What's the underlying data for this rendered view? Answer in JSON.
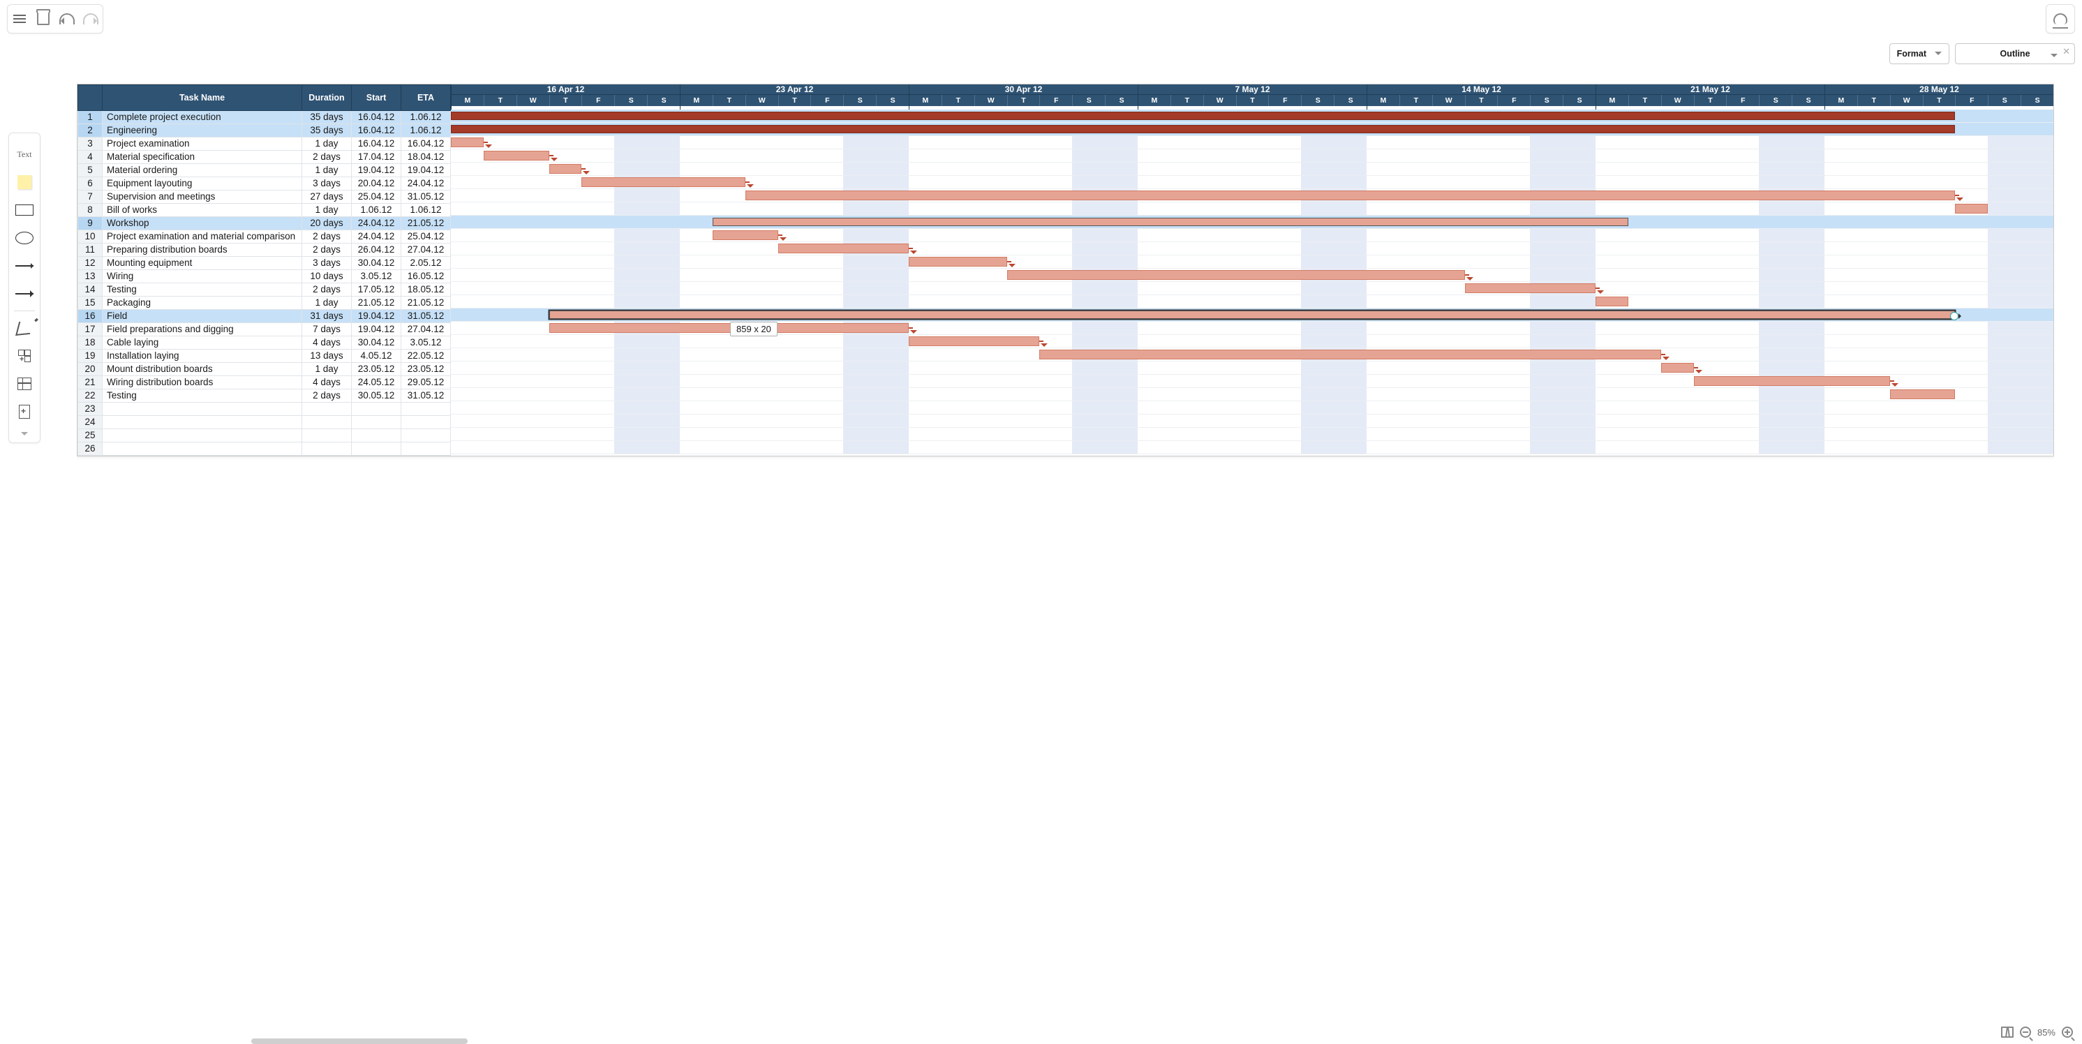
{
  "toolbar": {
    "format_label": "Format",
    "outline_label": "Outline"
  },
  "zoom": {
    "percent_label": "85%"
  },
  "tooltip": {
    "text": "859 x 20"
  },
  "columns": {
    "task": "Task Name",
    "duration": "Duration",
    "start": "Start",
    "eta": "ETA"
  },
  "weeks": [
    "16 Apr 12",
    "23 Apr 12",
    "30 Apr 12",
    "7 May 12",
    "14 May 12",
    "21 May 12",
    "28 May 12"
  ],
  "day_letters": [
    "M",
    "T",
    "W",
    "T",
    "F",
    "S",
    "S"
  ],
  "rows": [
    {
      "n": 1,
      "name": "Complete project execution",
      "dur": "35 days",
      "start": "16.04.12",
      "eta": "1.06.12",
      "summary": true,
      "bar": [
        0,
        46
      ],
      "bartype": "summary"
    },
    {
      "n": 2,
      "name": "Engineering",
      "dur": "35 days",
      "start": "16.04.12",
      "eta": "1.06.12",
      "summary": true,
      "bar": [
        0,
        46
      ],
      "bartype": "summary"
    },
    {
      "n": 3,
      "name": "Project examination",
      "dur": "1 day",
      "start": "16.04.12",
      "eta": "16.04.12",
      "summary": false,
      "bar": [
        0,
        1
      ],
      "link": true
    },
    {
      "n": 4,
      "name": "Material specification",
      "dur": "2 days",
      "start": "17.04.12",
      "eta": "18.04.12",
      "summary": false,
      "bar": [
        1,
        3
      ],
      "link": true
    },
    {
      "n": 5,
      "name": "Material ordering",
      "dur": "1 day",
      "start": "19.04.12",
      "eta": "19.04.12",
      "summary": false,
      "bar": [
        3,
        4
      ],
      "link": true
    },
    {
      "n": 6,
      "name": "Equipment layouting",
      "dur": "3 days",
      "start": "20.04.12",
      "eta": "24.04.12",
      "summary": false,
      "bar": [
        4,
        9
      ],
      "link": true
    },
    {
      "n": 7,
      "name": "Supervision and meetings",
      "dur": "27 days",
      "start": "25.04.12",
      "eta": "31.05.12",
      "summary": false,
      "bar": [
        9,
        46
      ],
      "link": true
    },
    {
      "n": 8,
      "name": "Bill of works",
      "dur": "1 day",
      "start": "1.06.12",
      "eta": "1.06.12",
      "summary": false,
      "bar": [
        46,
        47
      ]
    },
    {
      "n": 9,
      "name": "Workshop",
      "dur": "20 days",
      "start": "24.04.12",
      "eta": "21.05.12",
      "summary": true,
      "bar": [
        8,
        36
      ],
      "bartype": "outlined"
    },
    {
      "n": 10,
      "name": "Project examination and material comparison",
      "dur": "2 days",
      "start": "24.04.12",
      "eta": "25.04.12",
      "summary": false,
      "bar": [
        8,
        10
      ],
      "link": true
    },
    {
      "n": 11,
      "name": "Preparing distribution boards",
      "dur": "2 days",
      "start": "26.04.12",
      "eta": "27.04.12",
      "summary": false,
      "bar": [
        10,
        14
      ],
      "link": true
    },
    {
      "n": 12,
      "name": "Mounting equipment",
      "dur": "3 days",
      "start": "30.04.12",
      "eta": "2.05.12",
      "summary": false,
      "bar": [
        14,
        17
      ],
      "link": true
    },
    {
      "n": 13,
      "name": "Wiring",
      "dur": "10 days",
      "start": "3.05.12",
      "eta": "16.05.12",
      "summary": false,
      "bar": [
        17,
        31
      ],
      "link": true
    },
    {
      "n": 14,
      "name": "Testing",
      "dur": "2 days",
      "start": "17.05.12",
      "eta": "18.05.12",
      "summary": false,
      "bar": [
        31,
        35
      ],
      "link": true
    },
    {
      "n": 15,
      "name": "Packaging",
      "dur": "1 day",
      "start": "21.05.12",
      "eta": "21.05.12",
      "summary": false,
      "bar": [
        35,
        36
      ]
    },
    {
      "n": 16,
      "name": "Field",
      "dur": "31 days",
      "start": "19.04.12",
      "eta": "31.05.12",
      "summary": true,
      "bar": [
        3,
        46
      ],
      "bartype": "selected"
    },
    {
      "n": 17,
      "name": "Field preparations and digging",
      "dur": "7 days",
      "start": "19.04.12",
      "eta": "27.04.12",
      "summary": false,
      "bar": [
        3,
        14
      ],
      "link": true
    },
    {
      "n": 18,
      "name": "Cable laying",
      "dur": "4 days",
      "start": "30.04.12",
      "eta": "3.05.12",
      "summary": false,
      "bar": [
        14,
        18
      ],
      "link": true
    },
    {
      "n": 19,
      "name": "Installation laying",
      "dur": "13 days",
      "start": "4.05.12",
      "eta": "22.05.12",
      "summary": false,
      "bar": [
        18,
        37
      ],
      "link": true
    },
    {
      "n": 20,
      "name": "Mount distribution boards",
      "dur": "1 day",
      "start": "23.05.12",
      "eta": "23.05.12",
      "summary": false,
      "bar": [
        37,
        38
      ],
      "link": true
    },
    {
      "n": 21,
      "name": "Wiring distribution boards",
      "dur": "4 days",
      "start": "24.05.12",
      "eta": "29.05.12",
      "summary": false,
      "bar": [
        38,
        44
      ],
      "link": true
    },
    {
      "n": 22,
      "name": "Testing",
      "dur": "2 days",
      "start": "30.05.12",
      "eta": "31.05.12",
      "summary": false,
      "bar": [
        44,
        46
      ]
    },
    {
      "n": 23,
      "name": "",
      "dur": "",
      "start": "",
      "eta": "",
      "summary": false
    },
    {
      "n": 24,
      "name": "",
      "dur": "",
      "start": "",
      "eta": "",
      "summary": false
    },
    {
      "n": 25,
      "name": "",
      "dur": "",
      "start": "",
      "eta": "",
      "summary": false
    },
    {
      "n": 26,
      "name": "",
      "dur": "",
      "start": "",
      "eta": "",
      "summary": false
    }
  ],
  "chart_data": {
    "type": "table",
    "title": "Gantt chart — Complete project execution",
    "columns": [
      "#",
      "Task Name",
      "Duration",
      "Start",
      "ETA"
    ],
    "date_range_start": "16.04.12",
    "date_range_end": "3.06.12",
    "rows": [
      [
        1,
        "Complete project execution",
        "35 days",
        "16.04.12",
        "1.06.12"
      ],
      [
        2,
        "Engineering",
        "35 days",
        "16.04.12",
        "1.06.12"
      ],
      [
        3,
        "Project examination",
        "1 day",
        "16.04.12",
        "16.04.12"
      ],
      [
        4,
        "Material specification",
        "2 days",
        "17.04.12",
        "18.04.12"
      ],
      [
        5,
        "Material ordering",
        "1 day",
        "19.04.12",
        "19.04.12"
      ],
      [
        6,
        "Equipment layouting",
        "3 days",
        "20.04.12",
        "24.04.12"
      ],
      [
        7,
        "Supervision and meetings",
        "27 days",
        "25.04.12",
        "31.05.12"
      ],
      [
        8,
        "Bill of works",
        "1 day",
        "1.06.12",
        "1.06.12"
      ],
      [
        9,
        "Workshop",
        "20 days",
        "24.04.12",
        "21.05.12"
      ],
      [
        10,
        "Project examination and material comparison",
        "2 days",
        "24.04.12",
        "25.04.12"
      ],
      [
        11,
        "Preparing distribution boards",
        "2 days",
        "26.04.12",
        "27.04.12"
      ],
      [
        12,
        "Mounting equipment",
        "3 days",
        "30.04.12",
        "2.05.12"
      ],
      [
        13,
        "Wiring",
        "10 days",
        "3.05.12",
        "16.05.12"
      ],
      [
        14,
        "Testing",
        "2 days",
        "17.05.12",
        "18.05.12"
      ],
      [
        15,
        "Packaging",
        "1 day",
        "21.05.12",
        "21.05.12"
      ],
      [
        16,
        "Field",
        "31 days",
        "19.04.12",
        "31.05.12"
      ],
      [
        17,
        "Field preparations and digging",
        "7 days",
        "19.04.12",
        "27.04.12"
      ],
      [
        18,
        "Cable laying",
        "4 days",
        "30.04.12",
        "3.05.12"
      ],
      [
        19,
        "Installation laying",
        "13 days",
        "4.05.12",
        "22.05.12"
      ],
      [
        20,
        "Mount distribution boards",
        "1 day",
        "23.05.12",
        "23.05.12"
      ],
      [
        21,
        "Wiring distribution boards",
        "4 days",
        "24.05.12",
        "29.05.12"
      ],
      [
        22,
        "Testing",
        "2 days",
        "30.05.12",
        "31.05.12"
      ]
    ]
  }
}
